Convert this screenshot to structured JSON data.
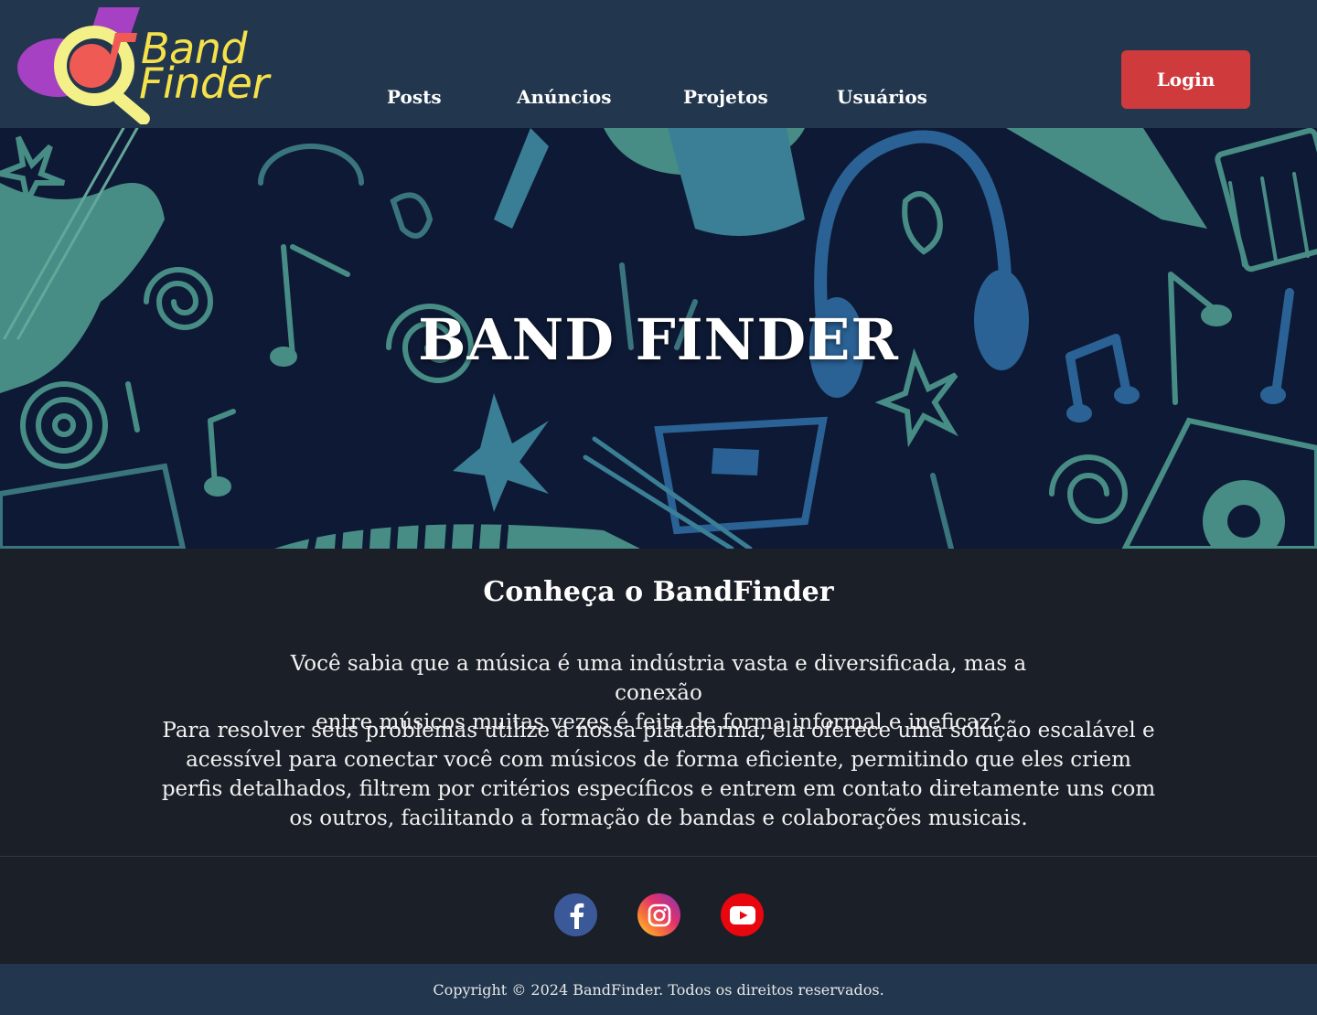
{
  "brand": {
    "logo_line1": "Band",
    "logo_line2": "Finder",
    "logo_color": "#f5e14a"
  },
  "nav": {
    "items": [
      {
        "label": "Posts"
      },
      {
        "label": "Anúncios"
      },
      {
        "label": "Projetos"
      },
      {
        "label": "Usuários"
      }
    ],
    "login_label": "Login"
  },
  "hero": {
    "title": "BAND FINDER"
  },
  "about": {
    "title": "Conheça o BandFinder",
    "paragraph1_line1": "Você sabia que a música é uma indústria vasta e diversificada,  mas a conexão",
    "paragraph1_line2": "entre músicos muitas vezes é feita de forma informal e ineficaz?",
    "paragraph2": "Para resolver seus problemas utilize a nossa plataforma, ela oferece uma solução escalável e acessível para conectar você com músicos de forma eficiente, permitindo que eles criem perfis detalhados, filtrem por critérios específicos e entrem em contato diretamente uns com os outros, facilitando a formação de bandas e colaborações musicais."
  },
  "social": {
    "icons": [
      "facebook-icon",
      "instagram-icon",
      "youtube-icon"
    ]
  },
  "footer": {
    "copyright": "Copyright © 2024 BandFinder. Todos os direitos reservados."
  },
  "colors": {
    "header_bg": "#22364d",
    "body_bg": "#1b1f27",
    "login_bg": "#cf3a3d",
    "hero_bg": "#0e1a35",
    "hero_accent_teal": "#4e9a8e",
    "hero_accent_blue": "#2f6aa0"
  }
}
